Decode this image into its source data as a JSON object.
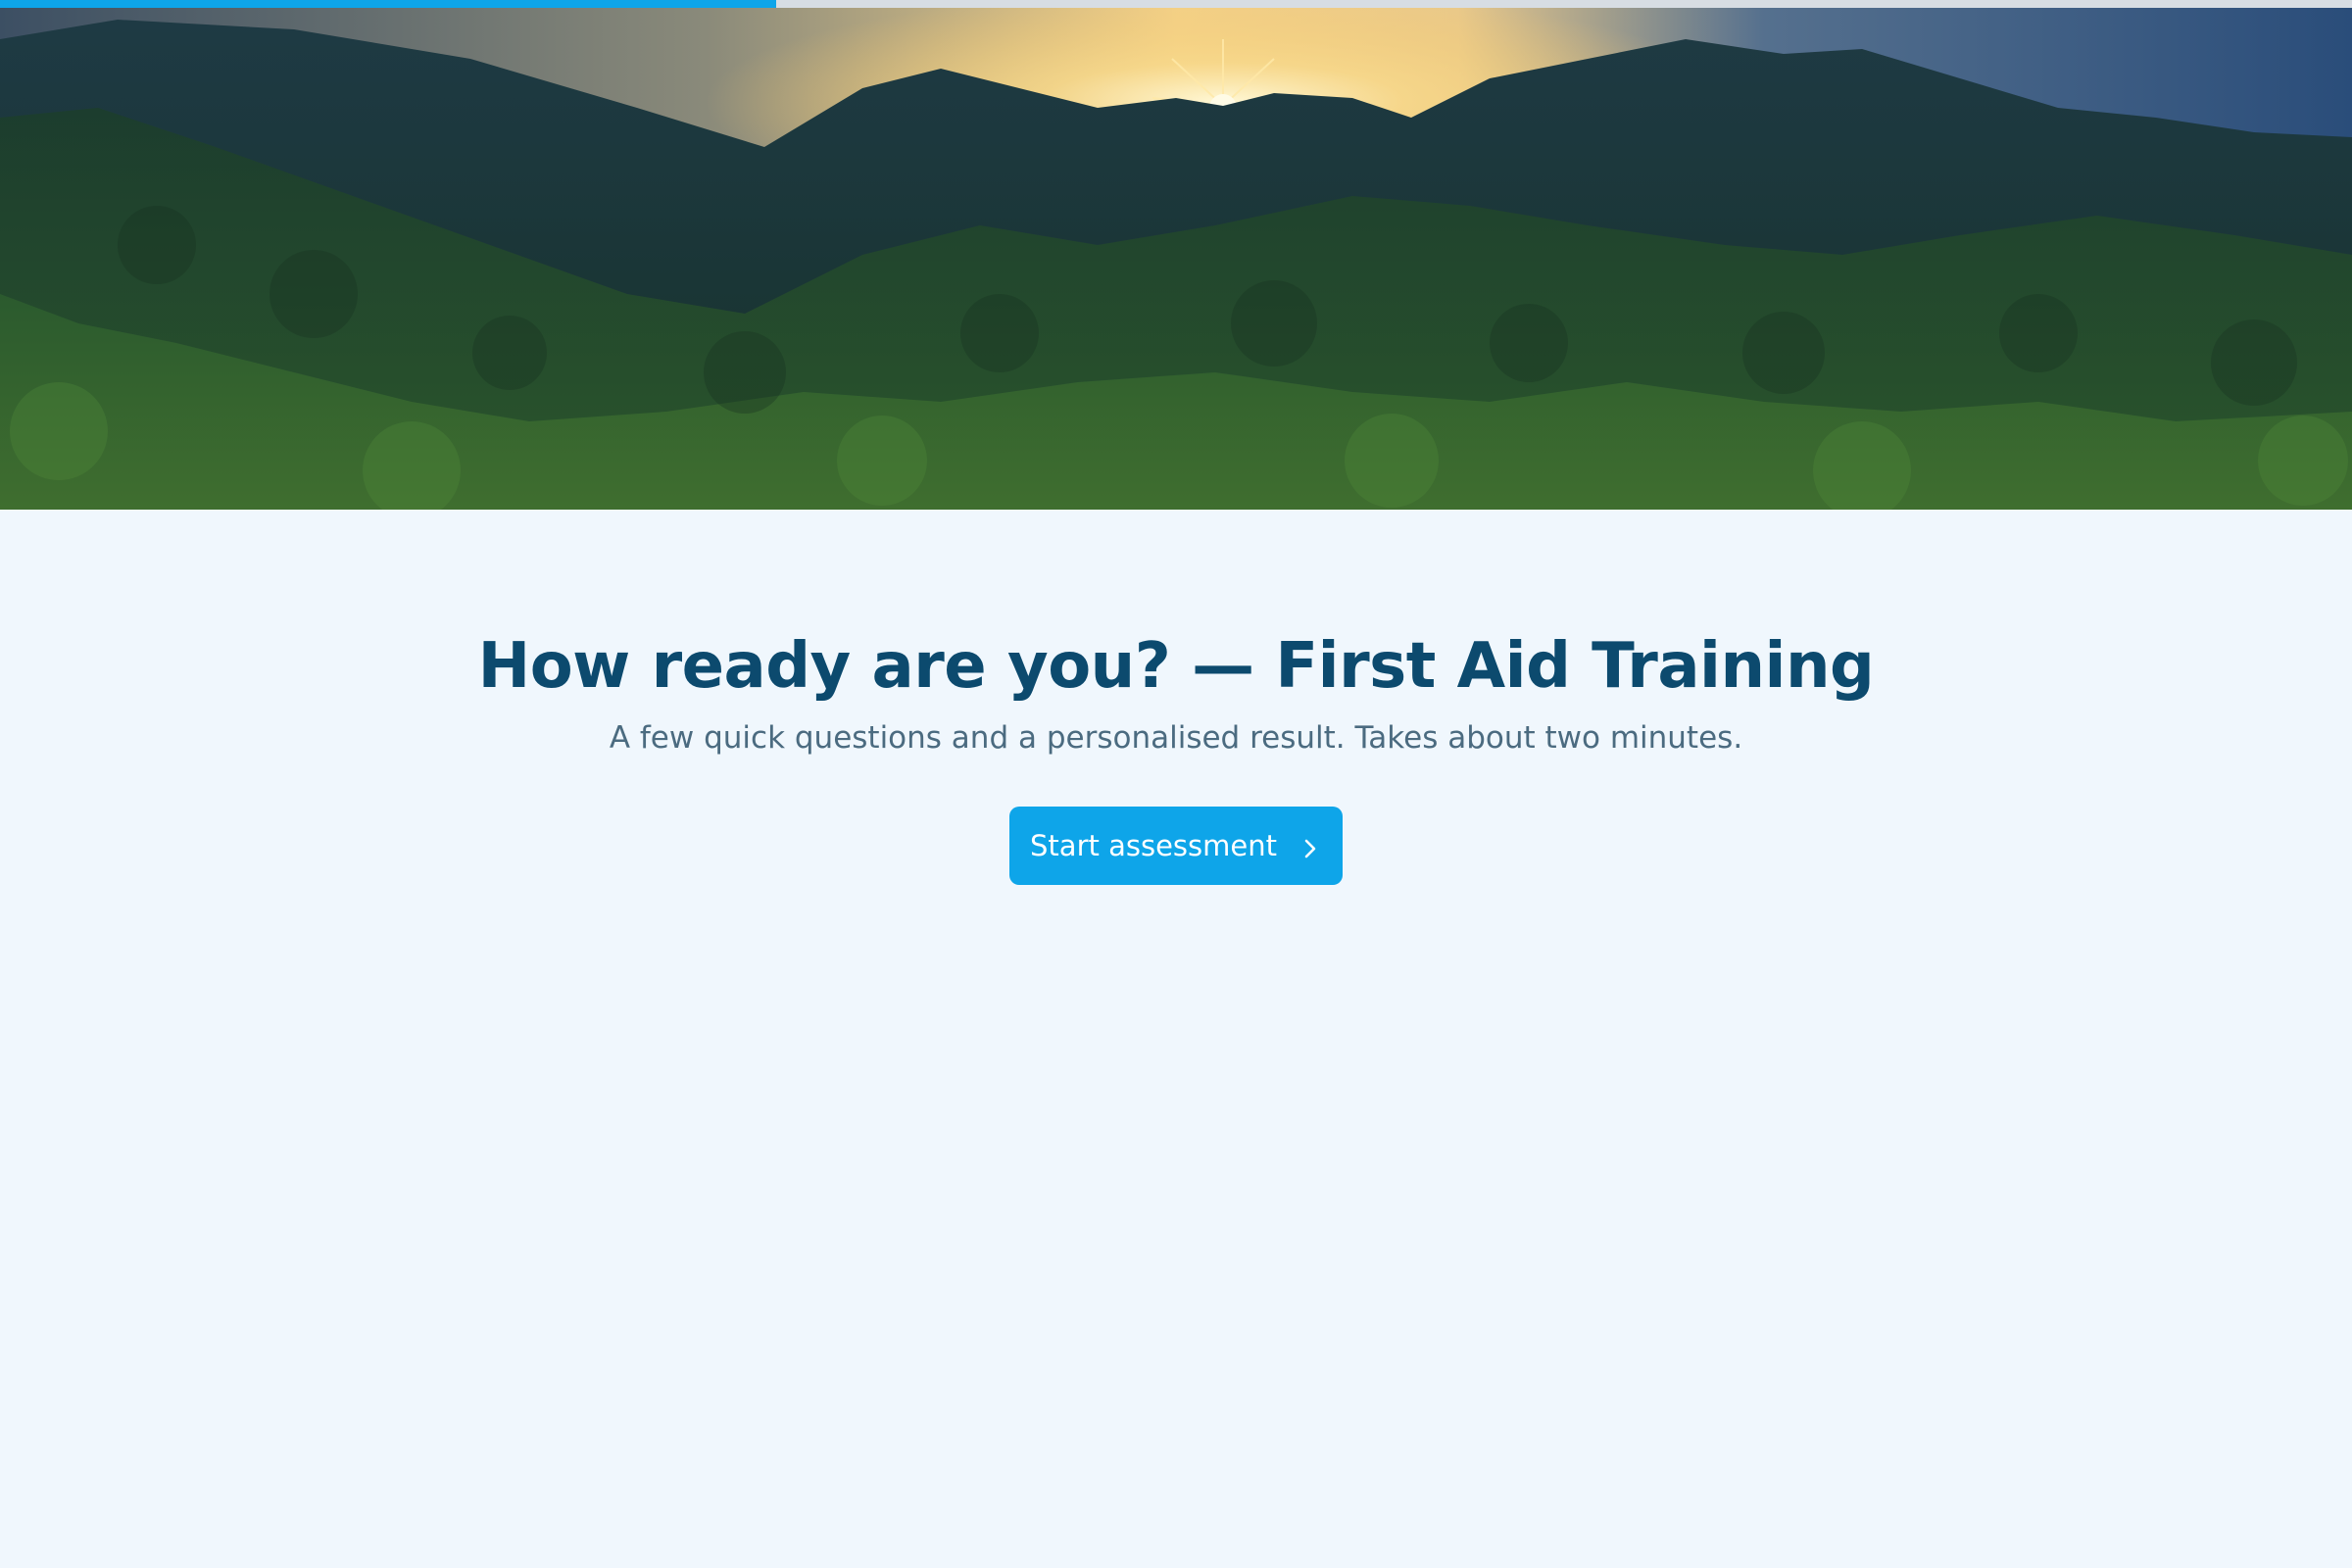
{
  "progress": {
    "fraction": 0.33
  },
  "hero": {
    "image": "mountain-sunrise-forest"
  },
  "main": {
    "title": "How ready are you? — First Aid Training",
    "subtitle": "A few quick questions and a personalised result. Takes about two minutes.",
    "start_button": {
      "label": "Start assessment",
      "icon": "chevron-right-icon"
    }
  },
  "colors": {
    "accent": "#0ea5e9",
    "title": "#0c4a6e",
    "subtitle": "#4b6b80",
    "background": "#f0f7fd"
  }
}
